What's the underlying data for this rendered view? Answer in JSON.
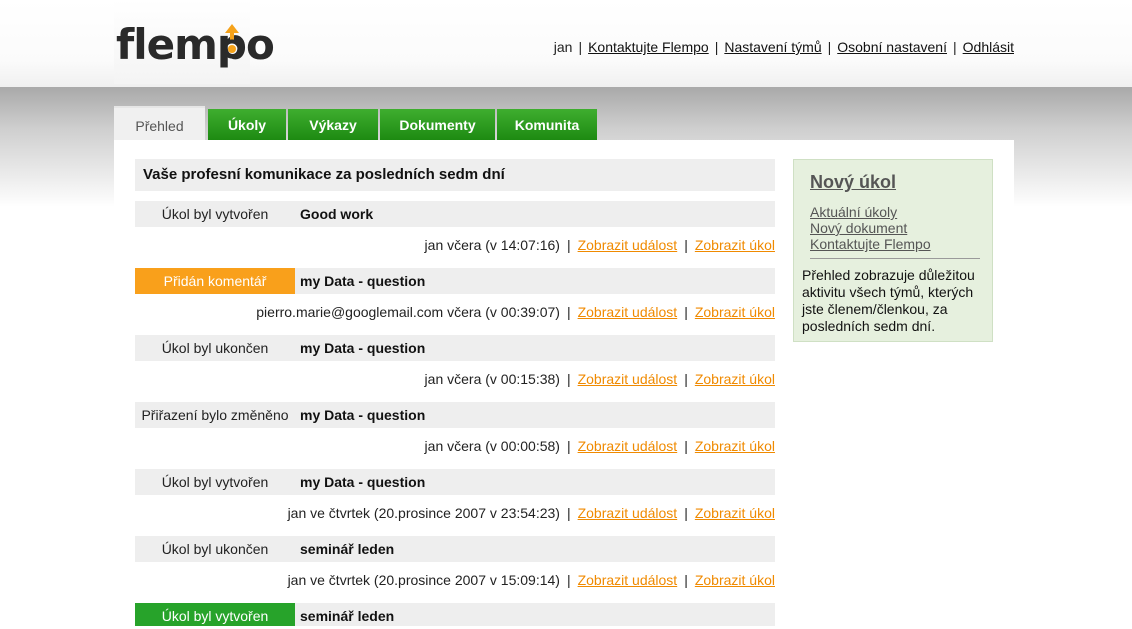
{
  "logo": {
    "text": "flempo"
  },
  "topnav": {
    "user": "jan",
    "contact": "Kontaktujte Flempo",
    "team_settings": "Nastavení týmů",
    "personal_settings": "Osobní nastavení",
    "logout": "Odhlásit"
  },
  "tabs": [
    {
      "label": "Přehled",
      "active": true
    },
    {
      "label": "Úkoly"
    },
    {
      "label": "Výkazy"
    },
    {
      "label": "Dokumenty"
    },
    {
      "label": "Komunita"
    }
  ],
  "main": {
    "heading": "Vaše profesní komunikace za posledních sedm dní",
    "link_event": "Zobrazit událost",
    "link_task": "Zobrazit úkol",
    "events": [
      {
        "type": "Úkol byl vytvořen",
        "task": "Good work",
        "meta": "jan včera (v 14:07:16)"
      },
      {
        "type": "Přidán komentář",
        "task": "my Data - question",
        "meta": "pierro.marie@googlemail.com včera (v 00:39:07)"
      },
      {
        "type": "Úkol byl ukončen",
        "task": "my Data - question",
        "meta": "jan včera (v 00:15:38)"
      },
      {
        "type": "Přiřazení bylo změněno",
        "task": "my Data - question",
        "meta": "jan včera (v 00:00:58)"
      },
      {
        "type": "Úkol byl vytvořen",
        "task": "my Data - question",
        "meta": "jan ve čtvrtek (20.prosince 2007 v 23:54:23)"
      },
      {
        "type": "Úkol byl ukončen",
        "task": "seminář leden",
        "meta": "jan ve čtvrtek (20.prosince 2007 v 15:09:14)"
      },
      {
        "type": "Úkol byl vytvořen",
        "task": "seminář leden"
      }
    ]
  },
  "sidebar": {
    "title": "Nový úkol",
    "links": [
      "Aktuální úkoly",
      "Nový dokument",
      "Kontaktujte Flempo"
    ],
    "description": "Přehled zobrazuje důležitou aktivitu všech týmů, kterých jste členem/členkou, za posledních sedm dní."
  },
  "colors": {
    "tab_green": "#27a32a",
    "highlight_orange": "#f9a01b",
    "link_orange": "#f08a00",
    "sidebar_bg": "#e6f0de"
  }
}
